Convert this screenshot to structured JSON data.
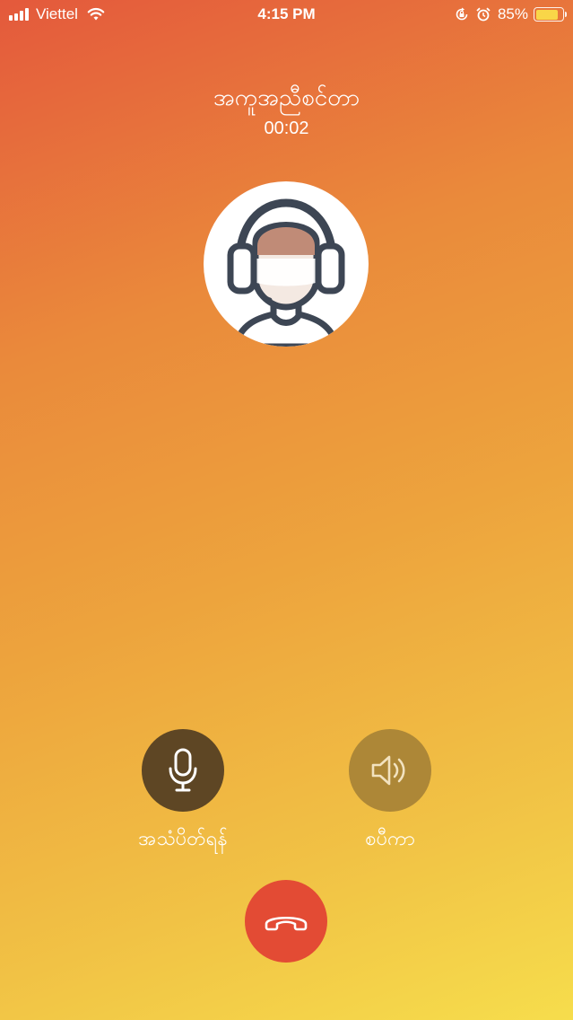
{
  "status_bar": {
    "carrier": "Viettel",
    "time": "4:15 PM",
    "battery_percent": "85%",
    "battery_level": 0.85,
    "icons": [
      "signal-icon",
      "wifi-icon",
      "orientation-lock-icon",
      "alarm-icon",
      "battery-icon"
    ]
  },
  "call": {
    "caller_name": "အကူအညီစင်တာ",
    "duration": "00:02",
    "avatar_icon": "headset-agent-avatar"
  },
  "controls": {
    "mute_label": "အသံပိတ်ရန်",
    "mute_icon": "microphone-icon",
    "speaker_label": "စပီကာ",
    "speaker_icon": "speaker-icon",
    "end_call_icon": "hang-up-phone-icon"
  },
  "colors": {
    "gradient_start": "#e4593c",
    "gradient_end": "#f6dd4c",
    "mute_button": "#5e4624",
    "speaker_button": "#ad8737",
    "end_call_button": "#e34b34",
    "battery_fill": "#f9d648"
  }
}
